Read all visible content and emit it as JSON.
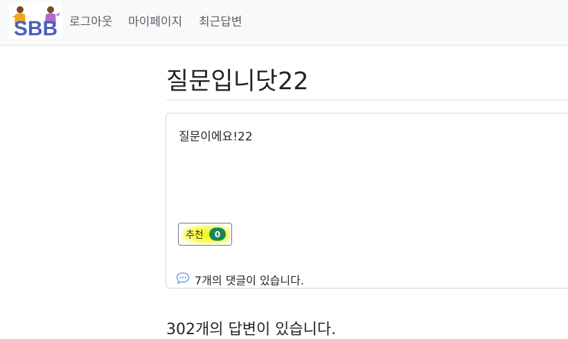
{
  "navbar": {
    "logo_text": "SBB",
    "links": [
      "로그아웃",
      "마이페이지",
      "최근답변"
    ]
  },
  "question": {
    "subject": "질문입니닷22",
    "content": "질문이에요!22",
    "vote_label": "추천",
    "vote_count": "0",
    "comment_text": "7개의 댓글이 있습니다."
  },
  "answers": {
    "count_text": "302개의 답변이 있습니다."
  },
  "colors": {
    "navbar_bg": "#f8f9fa",
    "badge_green": "#198754",
    "logo_blue": "#4a5fc1",
    "comment_icon": "#7aa7e0",
    "highlight_yellow": "#f5f500"
  }
}
